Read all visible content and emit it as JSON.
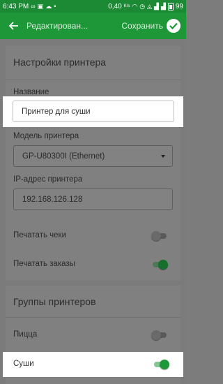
{
  "status_bar": {
    "time": "6:43 PM",
    "data_rate": "0,40",
    "data_rate_unit": "K/s",
    "battery": "99"
  },
  "app_bar": {
    "title": "Редактирован...",
    "save_label": "Сохранить"
  },
  "printer_settings": {
    "section_title": "Настройки принтера",
    "name_label": "Название",
    "name_value": "Принтер для суши",
    "model_label": "Модель принтера",
    "model_value": "GP-U80300I (Ethernet)",
    "ip_label": "IP-адрес принтера",
    "ip_value": "192.168.126.128",
    "print_checks_label": "Печатать чеки",
    "print_checks_on": false,
    "print_orders_label": "Печатать заказы",
    "print_orders_on": true
  },
  "printer_groups": {
    "section_title": "Группы принтеров",
    "items": [
      {
        "label": "Пицца",
        "on": false
      },
      {
        "label": "Суши",
        "on": true
      }
    ]
  },
  "colors": {
    "status_bar": "#1c8a34",
    "app_bar": "#1e9738",
    "accent": "#1e9738"
  }
}
